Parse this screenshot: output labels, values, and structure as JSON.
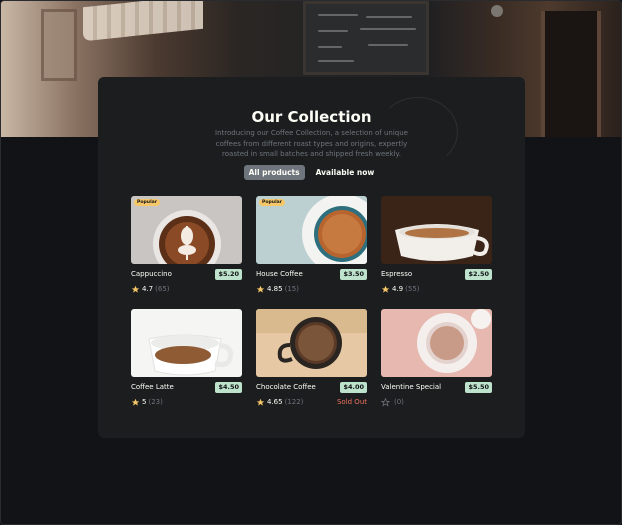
{
  "collection": {
    "title": "Our Collection",
    "intro": "Introducing our Coffee Collection, a selection of unique coffees from different roast types and origins, expertly roasted in small batches and shipped fresh weekly."
  },
  "filters": [
    {
      "label": "All products",
      "active": true
    },
    {
      "label": "Available now",
      "active": false
    }
  ],
  "products": [
    {
      "name": "Cappuccino",
      "price": "$5.20",
      "rating": "4.7",
      "votes": "(65)",
      "popular": "Popular",
      "sold_out": ""
    },
    {
      "name": "House Coffee",
      "price": "$3.50",
      "rating": "4.85",
      "votes": "(15)",
      "popular": "Popular",
      "sold_out": ""
    },
    {
      "name": "Espresso",
      "price": "$2.50",
      "rating": "4.9",
      "votes": "(55)",
      "popular": "",
      "sold_out": ""
    },
    {
      "name": "Coffee Latte",
      "price": "$4.50",
      "rating": "5",
      "votes": "(23)",
      "popular": "",
      "sold_out": ""
    },
    {
      "name": "Chocolate Coffee",
      "price": "$4.00",
      "rating": "4.65",
      "votes": "(122)",
      "popular": "",
      "sold_out": "Sold Out"
    },
    {
      "name": "Valentine Special",
      "price": "$5.50",
      "rating": "",
      "votes": "(0)",
      "popular": "",
      "sold_out": ""
    }
  ],
  "colors": {
    "background": "#121316",
    "card": "#1b1d1f",
    "muted": "#6f757c",
    "text": "#fefef7",
    "price_bg": "#bee3cc",
    "badge_bg": "#f6c768",
    "sold_out": "#ed735d"
  }
}
